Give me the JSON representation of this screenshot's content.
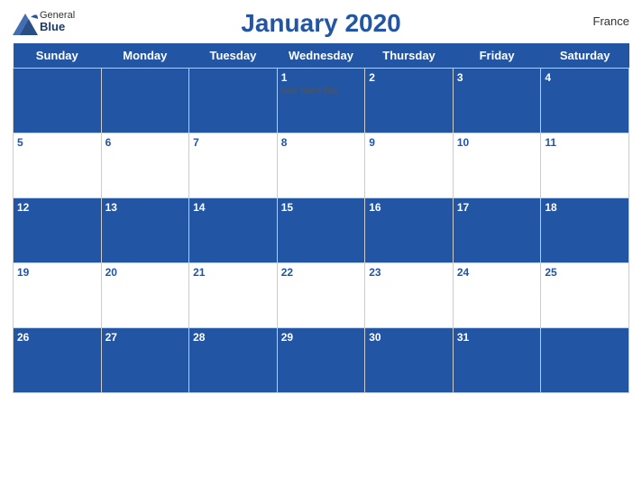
{
  "header": {
    "logo_general": "General",
    "logo_blue": "Blue",
    "title": "January 2020",
    "country": "France"
  },
  "days_of_week": [
    "Sunday",
    "Monday",
    "Tuesday",
    "Wednesday",
    "Thursday",
    "Friday",
    "Saturday"
  ],
  "weeks": [
    {
      "row_style": "blue",
      "days": [
        {
          "number": "",
          "holiday": ""
        },
        {
          "number": "",
          "holiday": ""
        },
        {
          "number": "",
          "holiday": ""
        },
        {
          "number": "1",
          "holiday": "New Year's Day"
        },
        {
          "number": "2",
          "holiday": ""
        },
        {
          "number": "3",
          "holiday": ""
        },
        {
          "number": "4",
          "holiday": ""
        }
      ]
    },
    {
      "row_style": "white",
      "days": [
        {
          "number": "5",
          "holiday": ""
        },
        {
          "number": "6",
          "holiday": ""
        },
        {
          "number": "7",
          "holiday": ""
        },
        {
          "number": "8",
          "holiday": ""
        },
        {
          "number": "9",
          "holiday": ""
        },
        {
          "number": "10",
          "holiday": ""
        },
        {
          "number": "11",
          "holiday": ""
        }
      ]
    },
    {
      "row_style": "blue",
      "days": [
        {
          "number": "12",
          "holiday": ""
        },
        {
          "number": "13",
          "holiday": ""
        },
        {
          "number": "14",
          "holiday": ""
        },
        {
          "number": "15",
          "holiday": ""
        },
        {
          "number": "16",
          "holiday": ""
        },
        {
          "number": "17",
          "holiday": ""
        },
        {
          "number": "18",
          "holiday": ""
        }
      ]
    },
    {
      "row_style": "white",
      "days": [
        {
          "number": "19",
          "holiday": ""
        },
        {
          "number": "20",
          "holiday": ""
        },
        {
          "number": "21",
          "holiday": ""
        },
        {
          "number": "22",
          "holiday": ""
        },
        {
          "number": "23",
          "holiday": ""
        },
        {
          "number": "24",
          "holiday": ""
        },
        {
          "number": "25",
          "holiday": ""
        }
      ]
    },
    {
      "row_style": "blue",
      "days": [
        {
          "number": "26",
          "holiday": ""
        },
        {
          "number": "27",
          "holiday": ""
        },
        {
          "number": "28",
          "holiday": ""
        },
        {
          "number": "29",
          "holiday": ""
        },
        {
          "number": "30",
          "holiday": ""
        },
        {
          "number": "31",
          "holiday": ""
        },
        {
          "number": "",
          "holiday": ""
        }
      ]
    }
  ]
}
